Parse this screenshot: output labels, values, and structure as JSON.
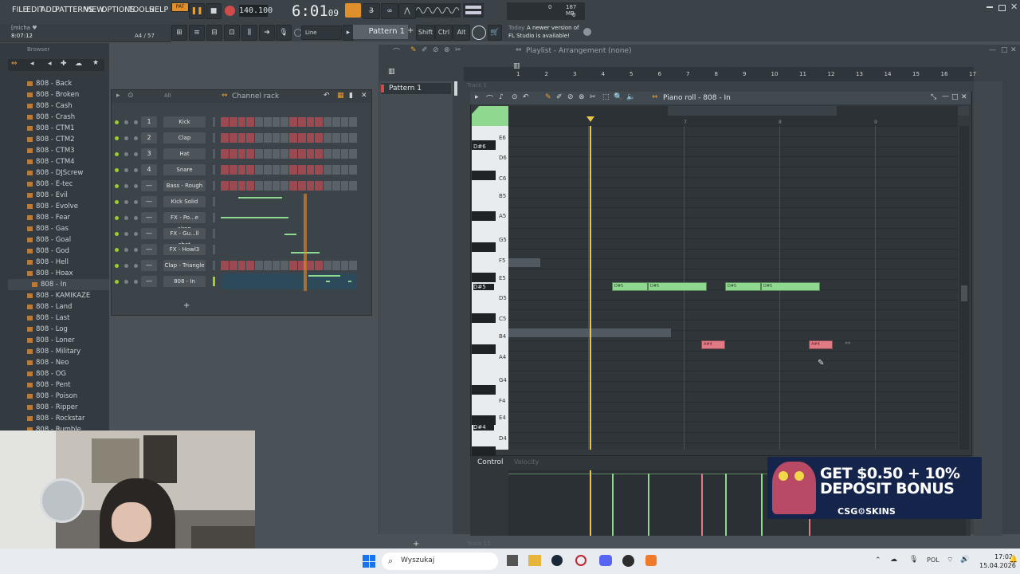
{
  "menubar": {
    "items": [
      "FILE",
      "EDIT",
      "ADD",
      "PATTERNS",
      "VIEW",
      "OPTIONS",
      "TOOLS",
      "HELP"
    ],
    "pat_label": "PAT",
    "tempo": "140.100",
    "time": "6:01",
    "time_sub": "09",
    "cpu": "0",
    "mem": "187 MB",
    "poly": "0"
  },
  "hint": {
    "user": "[micha ♥",
    "time": "8:07:12",
    "position": "A4 / 57"
  },
  "toolbar2": {
    "line_mode": "Line",
    "pattern": "Pattern 1",
    "shift": "Shift",
    "ctrl": "Ctrl",
    "alt": "Alt",
    "news_day": "Today",
    "news_text": "A newer version of",
    "news_text2": "FL Studio is available!"
  },
  "browser": {
    "title": "Browser",
    "items": [
      "808 - Back",
      "808 - Broken",
      "808 - Cash",
      "808 - Crash",
      "808 - CTM1",
      "808 - CTM2",
      "808 - CTM3",
      "808 - CTM4",
      "808 - DJScrew",
      "808 - E-tec",
      "808 - Evil",
      "808 - Evolve",
      "808 - Fear",
      "808 - Gas",
      "808 - Goal",
      "808 - God",
      "808 - Hell",
      "808 - Hoax",
      "808 - In",
      "808 - KAMIKAZE",
      "808 - Land",
      "808 - Last",
      "808 - Log",
      "808 - Loner",
      "808 - Military",
      "808 - Neo",
      "808 - OG",
      "808 - Pent",
      "808 - Poison",
      "808 - Ripper",
      "808 - Rockstar",
      "808 - Rumble"
    ],
    "selected_index": 18
  },
  "rack": {
    "title": "Channel rack",
    "filter": "All",
    "channels": [
      {
        "num": "1",
        "name": "Kick"
      },
      {
        "num": "2",
        "name": "Clap"
      },
      {
        "num": "3",
        "name": "Hat"
      },
      {
        "num": "4",
        "name": "Snare"
      },
      {
        "num": "—",
        "name": "Bass - Rough"
      },
      {
        "num": "—",
        "name": "Kick Solid"
      },
      {
        "num": "—",
        "name": "FX - Po...e siren"
      },
      {
        "num": "—",
        "name": "FX - Gu...ll shot"
      },
      {
        "num": "—",
        "name": "FX - Howl3"
      },
      {
        "num": "—",
        "name": "Clap - Triangle"
      },
      {
        "num": "—",
        "name": "808 - In"
      }
    ],
    "add_label": "+"
  },
  "playlist": {
    "title": "Playlist - Arrangement",
    "arrangement": "(none)",
    "pattern_item": "Pattern 1",
    "track1": "Track 1",
    "track15": "Track 15",
    "bars": [
      "1",
      "2",
      "3",
      "4",
      "5",
      "6",
      "7",
      "8",
      "9",
      "10",
      "11",
      "12",
      "13",
      "14",
      "15",
      "16",
      "17"
    ]
  },
  "pianoroll": {
    "title": "Piano roll - 808 - In",
    "bars": [
      "7",
      "8",
      "9"
    ],
    "keys": [
      "E6",
      "D#6",
      "D6",
      "C6",
      "B5",
      "A5",
      "G5",
      "F5",
      "E5",
      "D#5",
      "D5",
      "C5",
      "B4",
      "A4",
      "G4",
      "F4",
      "E4",
      "D#4",
      "D4"
    ],
    "notes_green_label": "D#5",
    "notes_red_label": "A#4"
  },
  "control": {
    "label": "Control",
    "param": "Velocity"
  },
  "ad": {
    "line1": "GET $0.50 + 10%",
    "line2": "DEPOSIT BONUS",
    "brand": "CSG⚙SKINS"
  },
  "taskbar": {
    "search": "Wyszukaj",
    "lang": "POL",
    "clock": "17:02",
    "date": "15.04.2026"
  },
  "colors": {
    "note_green": "#8fd88f",
    "note_red": "#e07a84",
    "playhead": "#e8c84a",
    "accent_orange": "#f0a030"
  }
}
